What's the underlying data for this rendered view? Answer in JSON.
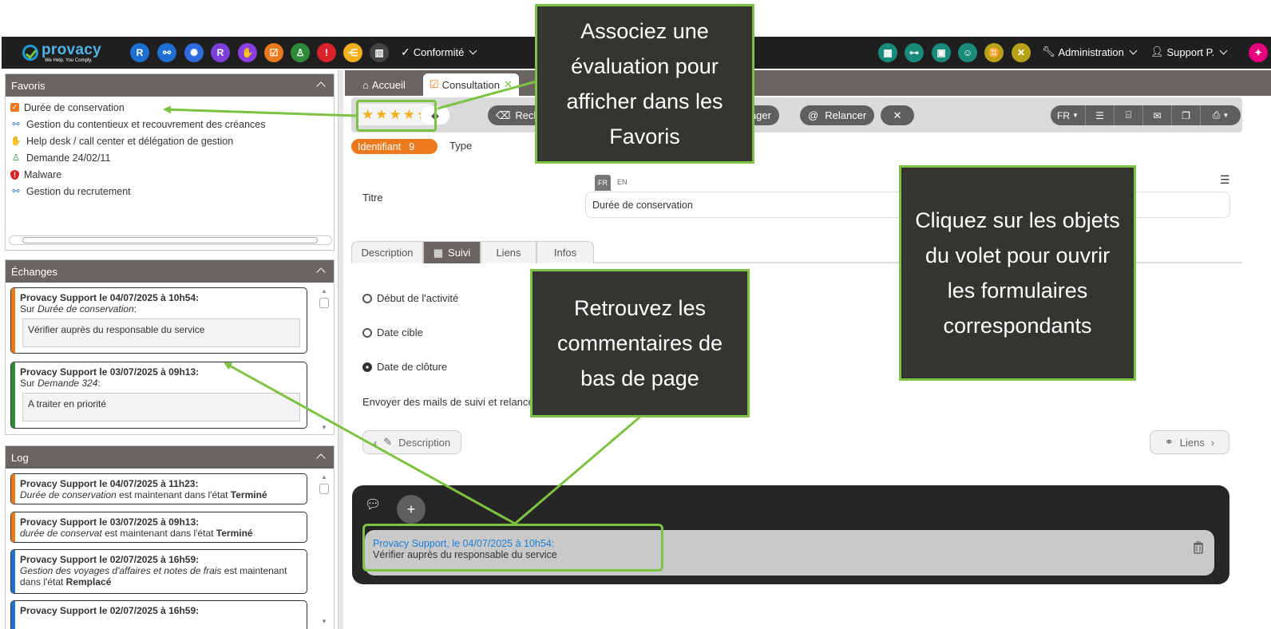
{
  "app": {
    "logo": "provacy",
    "logo_tagline": "We Help. You Comply.",
    "accent": "#7dc242",
    "topbar_color": "#1f1f1f"
  },
  "topbar": {
    "modules": [
      {
        "letter": "R",
        "color": "#1d6fd1"
      },
      {
        "letter": "",
        "color": "#1d6fd1",
        "icon": "network-icon"
      },
      {
        "letter": "",
        "color": "#2f6bdf",
        "icon": "virus-icon"
      },
      {
        "letter": "R",
        "color": "#7c3fd9"
      },
      {
        "letter": "",
        "color": "#8a3fe0",
        "icon": "handshake-icon"
      },
      {
        "letter": "",
        "color": "#ec7a1c",
        "icon": "checkbox-icon"
      },
      {
        "letter": "",
        "color": "#2f8a3c",
        "icon": "user-shield-icon"
      },
      {
        "letter": "",
        "color": "#d9232a",
        "icon": "shield-alert-icon"
      },
      {
        "letter": "",
        "color": "#f2b01e",
        "icon": "share-icon"
      },
      {
        "letter": "",
        "color": "#444444",
        "icon": "books-icon"
      }
    ],
    "conformite_label": "Conformité",
    "right_icons": [
      {
        "icon": "building-icon",
        "color": "#1a8a7a"
      },
      {
        "icon": "org-chart-icon",
        "color": "#1a8a7a"
      },
      {
        "icon": "office-icon",
        "color": "#1a8a7a"
      },
      {
        "icon": "group-icon",
        "color": "#1a8a7a"
      },
      {
        "icon": "people-icon",
        "color": "#b8a21a"
      },
      {
        "icon": "tools-icon",
        "color": "#b8a21a"
      }
    ],
    "admin_label": "Administration",
    "user_label": "Support P."
  },
  "favoris": {
    "title": "Favoris",
    "items": [
      {
        "label": "Durée de conservation",
        "icon": "checkbox-icon",
        "color": "#ec7a1c"
      },
      {
        "label": "Gestion du contentieux et recouvrement des créances",
        "icon": "network-icon",
        "color": "#1d6fd1"
      },
      {
        "label": "Help desk / call center et délégation de gestion",
        "icon": "handshake-icon",
        "color": "#8a3fe0"
      },
      {
        "label": "Demande 24/02/11",
        "icon": "user-shield-icon",
        "color": "#2f8a3c"
      },
      {
        "label": "Malware",
        "icon": "shield-alert-icon",
        "color": "#d9232a"
      },
      {
        "label": "Gestion du recrutement",
        "icon": "network-icon",
        "color": "#1d6fd1"
      }
    ]
  },
  "echanges": {
    "title": "Échanges",
    "cards": [
      {
        "title": "Provacy Support le 04/07/2025 à 10h54:",
        "prefix": "Sur ",
        "object": "Durée de conservation",
        "suffix": ":",
        "comment": "Vérifier auprès du responsable du service",
        "color": "orange"
      },
      {
        "title": "Provacy Support le 03/07/2025 à 09h13:",
        "prefix": "Sur ",
        "object": "Demande 324",
        "suffix": ":",
        "comment": "A traiter en priorité",
        "color": "green"
      }
    ]
  },
  "log": {
    "title": "Log",
    "entries": [
      {
        "title": "Provacy Support le 04/07/2025 à 11h23:",
        "object": "Durée de conservation",
        "mid": " est maintenant dans l'état ",
        "state": "Terminé",
        "color": "orange"
      },
      {
        "title": "Provacy Support le 03/07/2025 à 09h13:",
        "object": "durée de conservat",
        "mid": " est maintenant dans l'état ",
        "state": "Terminé",
        "color": "orange"
      },
      {
        "title": "Provacy Support le 02/07/2025 à 16h59:",
        "object": "Gestion des voyages d'affaires et notes de frais",
        "mid": " est maintenant",
        "line2": "dans l'état ",
        "state": "Remplacé",
        "color": "blue"
      },
      {
        "title": "Provacy Support le 02/07/2025 à 16h59:",
        "color": "blue"
      }
    ]
  },
  "tabs": {
    "home": "Accueil",
    "active": "Consultation"
  },
  "toolbar": {
    "rating": 5,
    "reclo_label": "Reclo",
    "partager_label": "rtager",
    "relancer_label": "Relancer",
    "lang_label": "FR"
  },
  "form": {
    "identifiant_label": "Identifiant",
    "identifiant_value": "9",
    "type_label": "Type",
    "titre_label": "Titre",
    "lang_fr": "FR",
    "lang_en": "EN",
    "titre_value": "Durée de conservation",
    "subtabs": [
      "Description",
      "Suivi",
      "Liens",
      "Infos"
    ],
    "debut_label": "Début de l'activité",
    "cible_label": "Date cible",
    "cloture_label": "Date de clôture",
    "mails_label": "Envoyer des mails de suivi et relance",
    "prev_label": "Description",
    "next_label": "Liens"
  },
  "comments": {
    "author": "Provacy Support, le 04/07/2025 à 10h54:",
    "text": "Vérifier auprès du responsable du service"
  },
  "callouts": {
    "favoris": [
      "Associez une",
      "évaluation pour",
      "afficher dans les",
      "Favoris"
    ],
    "volet": [
      "Cliquez sur les objets",
      "du volet pour ouvrir",
      "les formulaires",
      "correspondants"
    ],
    "commentaires": [
      "Retrouvez les",
      "commentaires de",
      "bas de page"
    ]
  }
}
